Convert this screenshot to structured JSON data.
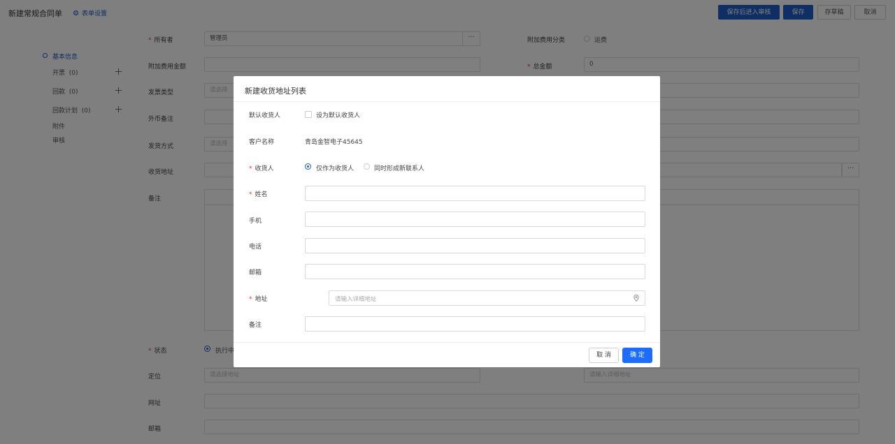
{
  "header": {
    "title": "新建常规合同单",
    "form_settings": "表单设置",
    "btn_save_approve": "保存后进入审核",
    "btn_save": "保存",
    "btn_draft": "存草稿",
    "btn_cancel": "取消"
  },
  "nav": {
    "items": [
      {
        "label": "基本信息",
        "count": ""
      },
      {
        "label": "开票",
        "count": "(0)"
      },
      {
        "label": "回款",
        "count": "(0)"
      },
      {
        "label": "回款计划",
        "count": "(0)"
      },
      {
        "label": "附件",
        "count": ""
      },
      {
        "label": "审核",
        "count": ""
      }
    ]
  },
  "form": {
    "owner_label": "所有者",
    "owner_value": "管理员",
    "extra_fee_type_label": "附加费用分类",
    "extra_fee_type_option": "运费",
    "extra_fee_amount_label": "附加费用金额",
    "total_label": "总金额",
    "total_value": "0",
    "invoice_type_label": "发票类型",
    "invoice_type_placeholder": "请选择",
    "fx_note_label": "外币备注",
    "ship_method_label": "发货方式",
    "ship_method_placeholder": "请选择",
    "ship_address_label": "收货地址",
    "remark_label": "备注",
    "status_label": "状态",
    "status_option": "执行中",
    "location_label": "定位",
    "location_placeholder": "请选择地址",
    "location_detail_placeholder": "请输入详细地址",
    "website_label": "网址",
    "email_label": "邮箱"
  },
  "modal": {
    "title": "新建收货地址列表",
    "default_receiver_label": "默认收货人",
    "default_receiver_checkbox": "设为默认收货人",
    "customer_name_label": "客户名称",
    "customer_name_value": "青岛金智电子45645",
    "receiver_label": "收货人",
    "receiver_option_1": "仅作为收货人",
    "receiver_option_2": "同时形成新联系人",
    "name_label": "姓名",
    "mobile_label": "手机",
    "phone_label": "电话",
    "email_label": "邮箱",
    "address_label": "地址",
    "address_placeholder": "请输入详细地址",
    "remark_label": "备注",
    "cancel_label": "取 消",
    "ok_label": "确 定"
  },
  "colors": {
    "primary": "#1f5cc8",
    "modal_ok": "#1a6dff",
    "required": "#ee3333"
  }
}
